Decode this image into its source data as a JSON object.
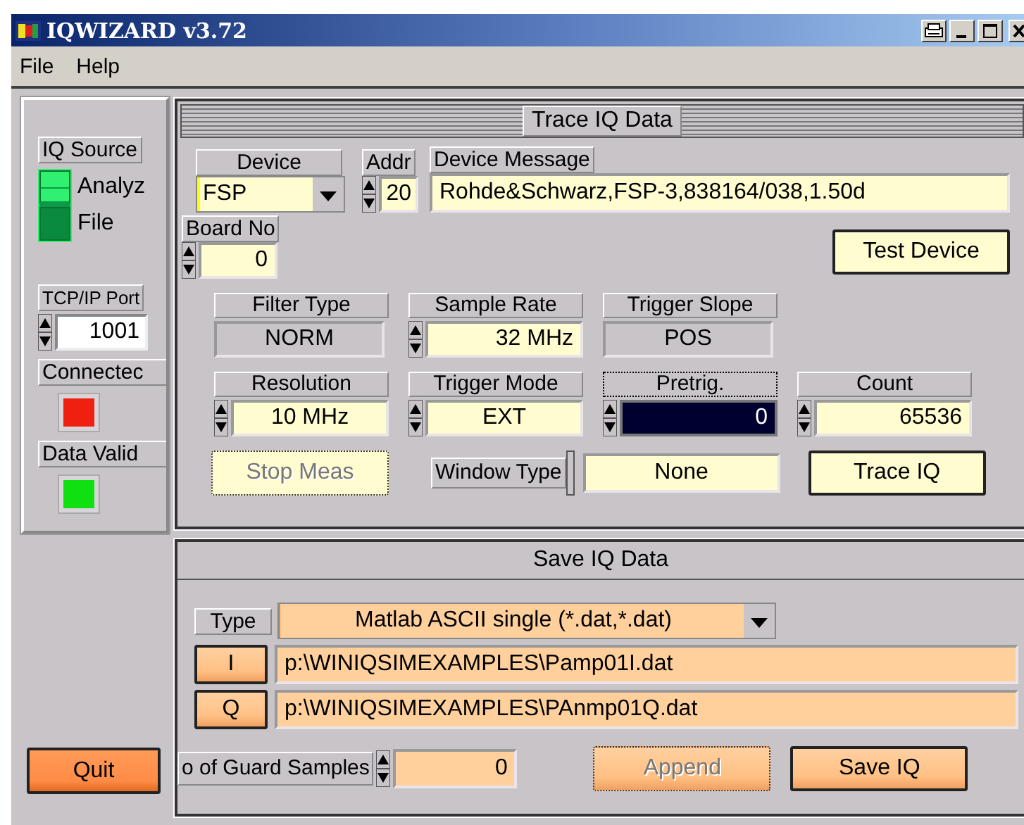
{
  "window": {
    "title": "IQWIZARD v3.72"
  },
  "menu": [
    {
      "label": "File"
    },
    {
      "label": "Help"
    }
  ],
  "source": {
    "label": "IQ Source",
    "options": [
      {
        "label": "Analyz",
        "selected": true
      },
      {
        "label": "File",
        "selected": false
      }
    ]
  },
  "port": {
    "label": "TCP/IP Port",
    "value": "1001"
  },
  "indicators": [
    {
      "label": "Connectec",
      "color": "#f02010"
    },
    {
      "label": "Data Valid",
      "color": "#10e010"
    }
  ],
  "quit": {
    "label": "Quit",
    "disabled": false
  },
  "trace": {
    "title": "Trace IQ Data",
    "device": {
      "label": "Device",
      "value": "FSP"
    },
    "addr": {
      "label": "Addr",
      "value": "20"
    },
    "message": {
      "label": "Device Message",
      "value": "Rohde&Schwarz,FSP-3,838164/038,1.50d"
    },
    "board": {
      "label": "Board No",
      "value": "0"
    },
    "test_button": {
      "label": "Test Device",
      "disabled": false
    },
    "settings_rows": [
      [
        {
          "kind": "indicator",
          "label": "Filter Type",
          "value": "NORM",
          "focused": false
        },
        {
          "kind": "numeric",
          "label": "Sample Rate",
          "value": "32 MHz",
          "focused": false
        },
        {
          "kind": "indicator",
          "label": "Trigger Slope",
          "value": "POS",
          "focused": false
        }
      ],
      [
        {
          "kind": "ring",
          "label": "Resolution",
          "value": "10 MHz",
          "focused": false
        },
        {
          "kind": "ring",
          "label": "Trigger Mode",
          "value": "EXT",
          "focused": false
        },
        {
          "kind": "numeric",
          "label": "Pretrig.",
          "value": "0",
          "focused": true
        },
        {
          "kind": "numeric",
          "label": "Count",
          "value": "65536",
          "focused": false
        }
      ]
    ],
    "stop_button": {
      "label": "Stop Meas",
      "disabled": true
    },
    "window_type": {
      "label": "Window Type",
      "value": "None"
    },
    "trace_button": {
      "label": "Trace IQ",
      "disabled": false
    }
  },
  "save": {
    "title": "Save IQ Data",
    "type": {
      "label": "Type",
      "value": "Matlab ASCII single (*.dat,*.dat)"
    },
    "files": [
      {
        "button": "I",
        "path": "p:\\WINIQSIMEXAMPLES\\Pamp01I.dat"
      },
      {
        "button": "Q",
        "path": "p:\\WINIQSIMEXAMPLES\\PAnmp01Q.dat"
      }
    ],
    "guard": {
      "label": "o of Guard Samples",
      "value": "0"
    },
    "append_button": {
      "label": "Append",
      "disabled": true
    },
    "save_button": {
      "label": "Save IQ",
      "disabled": false
    }
  }
}
